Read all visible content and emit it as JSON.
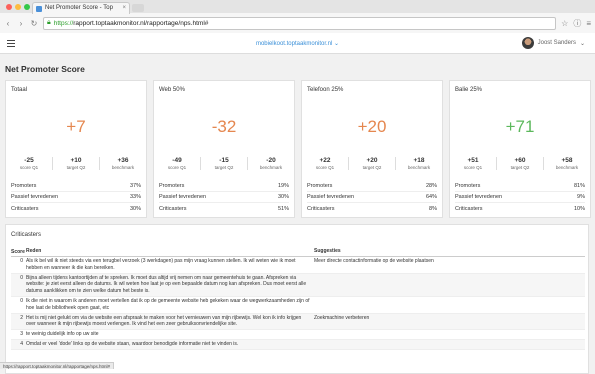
{
  "browser": {
    "tab_title": "Net Promoter Score - Top",
    "tab_close": "×",
    "url_https": "https://",
    "url_rest": "rapport.toptaakmonitor.nl/rapportage/nps.html#",
    "back": "‹",
    "forward": "›",
    "reload": "↻",
    "star": "☆",
    "menu": "≡",
    "info": "ⓘ"
  },
  "header": {
    "org": "mobielkoot.toptaakmonitor.nl",
    "user_name": "Joost Sanders"
  },
  "page": {
    "title": "Net Promoter Score"
  },
  "cards": [
    {
      "title": "Totaal",
      "nps": "+7",
      "nps_color": "#e5874f",
      "stats": [
        {
          "value": "-25",
          "label": "score Q1"
        },
        {
          "value": "+10",
          "label": "target Q2"
        },
        {
          "value": "+36",
          "label": "benchmark"
        }
      ],
      "rows": [
        {
          "label": "Promoters",
          "value": "37%"
        },
        {
          "label": "Passief tevredenen",
          "value": "33%"
        },
        {
          "label": "Criticasters",
          "value": "30%"
        }
      ]
    },
    {
      "title": "Web 50%",
      "nps": "-32",
      "nps_color": "#e5874f",
      "stats": [
        {
          "value": "-49",
          "label": "score Q1"
        },
        {
          "value": "-15",
          "label": "target Q2"
        },
        {
          "value": "-20",
          "label": "benchmark"
        }
      ],
      "rows": [
        {
          "label": "Promoters",
          "value": "19%"
        },
        {
          "label": "Passief tevredenen",
          "value": "30%"
        },
        {
          "label": "Criticasters",
          "value": "51%"
        }
      ]
    },
    {
      "title": "Telefoon 25%",
      "nps": "+20",
      "nps_color": "#e5874f",
      "stats": [
        {
          "value": "+22",
          "label": "score Q1"
        },
        {
          "value": "+20",
          "label": "target Q2"
        },
        {
          "value": "+18",
          "label": "benchmark"
        }
      ],
      "rows": [
        {
          "label": "Promoters",
          "value": "28%"
        },
        {
          "label": "Passief tevredenen",
          "value": "64%"
        },
        {
          "label": "Criticasters",
          "value": "8%"
        }
      ]
    },
    {
      "title": "Balie 25%",
      "nps": "+71",
      "nps_color": "#5cb85c",
      "stats": [
        {
          "value": "+51",
          "label": "score Q1"
        },
        {
          "value": "+60",
          "label": "target Q2"
        },
        {
          "value": "+58",
          "label": "benchmark"
        }
      ],
      "rows": [
        {
          "label": "Promoters",
          "value": "81%"
        },
        {
          "label": "Passief tevredenen",
          "value": "9%"
        },
        {
          "label": "Criticasters",
          "value": "10%"
        }
      ]
    }
  ],
  "critics": {
    "title": "Criticasters",
    "headers": {
      "score": "Score",
      "reason": "Reden",
      "suggestion": "Suggesties"
    },
    "rows": [
      {
        "score": "0",
        "reason": "Als ik bel wil ik niet steeds via een terugbel verzoek (3 werkdagen) pas mijn vraag kunnen stellen. Ik wil weten wie ik moet hebben en wanneer ik die kan bereiken.",
        "suggestion": "Meer directe contactinformatie op de website plaatsen"
      },
      {
        "score": "0",
        "reason": "Bijna alleen tijdens kantoortijden af te spreken. Ik moet dus altijd vrij nemen om naar gemeentehuis te gaan. Afspreken via website: je ziet eerst alleen de datums. Ik wil weten hoe laat je op een bepaalde datum nog kan afspreken. Dus moet eerst alle datums aanklikken om te zien welke datum het beste is.",
        "suggestion": ""
      },
      {
        "score": "0",
        "reason": "Ik die niet in waarom ik anderen moet vertellen dat ik op de gemeente website heb gekeken waar de wegwerkzaamheden zijn of hoe laat de bibliotheek open gaat, etc",
        "suggestion": ""
      },
      {
        "score": "2",
        "reason": "Het is mij niet gelukt om via de website een afspraak te maken voor het vernieuwen van mijn rijbewijs. Wel kon ik info krijgen over wanneer ik mijn rijbewijs moest verlengen. Ik vind het een zeer gebruiksonvriendelijke site.",
        "suggestion": "Zoekmachine verbeteren"
      },
      {
        "score": "3",
        "reason": "te weinig duidelijk info op uw site",
        "suggestion": ""
      },
      {
        "score": "4",
        "reason": "Omdat er veel 'dode' links op de website staan, waardoor benodigde informatie niet te vinden is.",
        "suggestion": ""
      }
    ]
  },
  "statusbar": {
    "text": "https://rapport.toptaakmonitor.nl/rapportage/nps.html#"
  }
}
